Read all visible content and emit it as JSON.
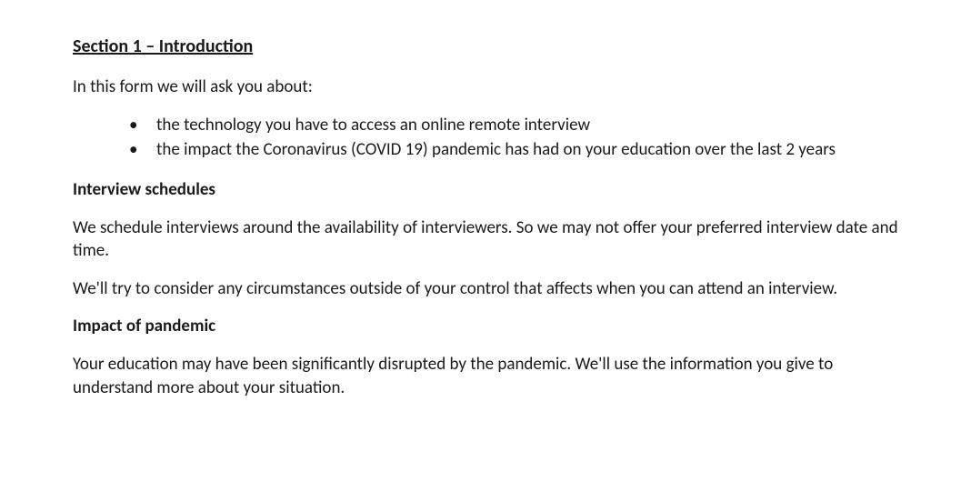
{
  "section_title": "Section 1 – Introduction",
  "intro_line": "In this form we will ask you about:",
  "bullets": [
    "the technology you have to access an online remote interview",
    "the impact the Coronavirus (COVID 19) pandemic has had on your education over the last 2 years"
  ],
  "interview_schedules": {
    "heading": "Interview schedules",
    "p1": "We schedule interviews around the availability of interviewers. So we may not offer your preferred interview date and time.",
    "p2": "We'll try to consider any circumstances outside of your control that affects when you can attend an interview."
  },
  "impact": {
    "heading": "Impact of pandemic",
    "p1": "Your education may have been significantly disrupted by the pandemic. We'll use the information you give to understand more about your situation."
  }
}
